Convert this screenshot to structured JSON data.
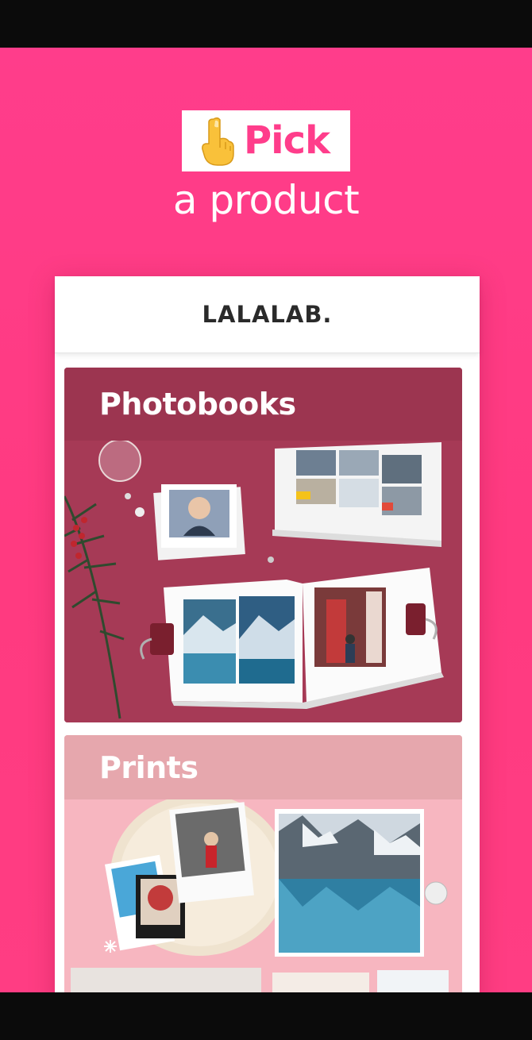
{
  "header": {
    "pick_label": "Pick",
    "subtitle": "a product"
  },
  "app": {
    "brand": "LALALAB."
  },
  "products": [
    {
      "title": "Photobooks"
    },
    {
      "title": "Prints"
    }
  ],
  "colors": {
    "background": "#ff3d8b",
    "pick_text": "#ff3d8b",
    "photobooks_header": "#9c3550",
    "photobooks_bg": "#a63a56",
    "prints_header": "#e6a7ad",
    "prints_bg": "#f7b6c0"
  },
  "icons": {
    "hand": "index-pointing-up-icon"
  }
}
